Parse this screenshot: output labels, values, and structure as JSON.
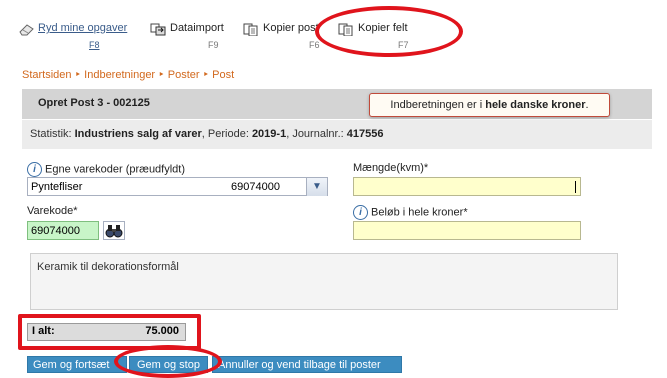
{
  "toolbar": {
    "items": [
      {
        "label": "Ryd mine opgaver",
        "key": "F8",
        "icon": "eraser-icon"
      },
      {
        "label": "Dataimport",
        "key": "F9",
        "icon": "data-import-icon"
      },
      {
        "label": "Kopier post",
        "key": "F6",
        "icon": "copy-post-icon"
      },
      {
        "label": "Kopier felt",
        "key": "F7",
        "icon": "copy-field-icon"
      }
    ]
  },
  "breadcrumb": [
    "Startsiden",
    "Indberetninger",
    "Poster",
    "Post"
  ],
  "form": {
    "title": "Opret Post 3 - 002125",
    "notice_prefix": "Indberetningen er i ",
    "notice_bold": "hele danske kroner",
    "notice_suffix": ".",
    "info": {
      "statistik_label": "Statistik: ",
      "statistik_value": "Industriens salg af varer",
      "periode_label": ", Periode: ",
      "periode_value": "2019-1",
      "journal_label": ", Journalnr.: ",
      "journal_value": "417556"
    },
    "egne_label": "Egne varekoder (præudfyldt)",
    "egne_text": "Pyntefliser",
    "egne_code": "69074000",
    "maengde_label": "Mængde(kvm)*",
    "maengde_value": "",
    "varekode_label": "Varekode*",
    "varekode_value": "69074000",
    "beloeb_label": "Beløb i hele kroner*",
    "beloeb_value": "",
    "description": "Keramik til dekorationsformål"
  },
  "total": {
    "label": "I alt:",
    "value": "75.000"
  },
  "buttons": {
    "save_continue": "Gem og fortsæt",
    "save_stop": "Gem og stop",
    "cancel": "Annuller og vend tilbage til poster"
  },
  "colors": {
    "accent_button": "#3c8cc0",
    "breadcrumb": "#d2691e",
    "highlight": "#e0141c",
    "required_field": "#ffffcc",
    "valid_field": "#c8f5c8"
  }
}
